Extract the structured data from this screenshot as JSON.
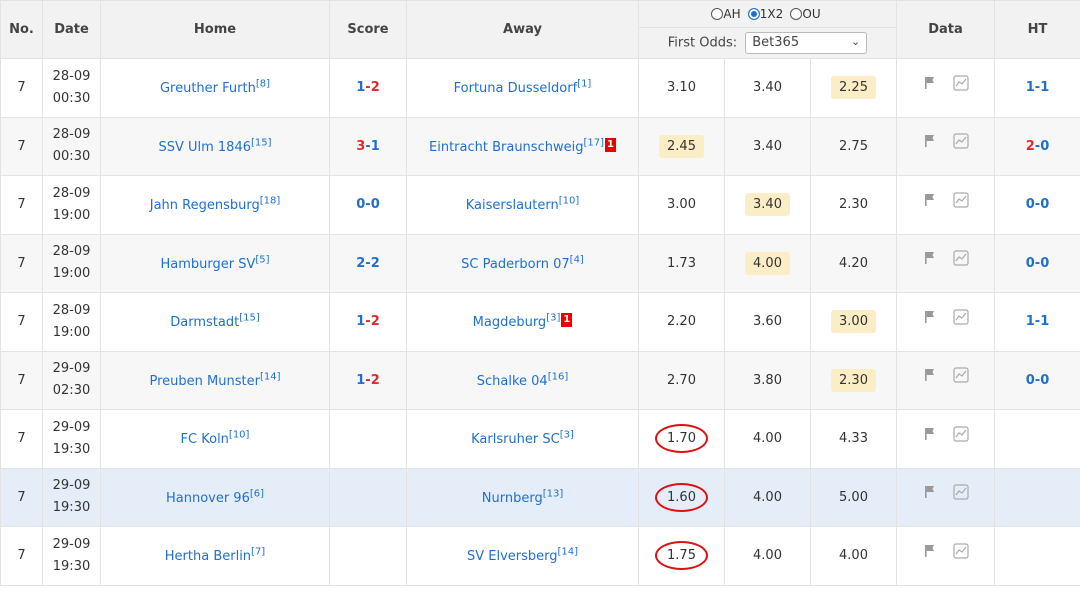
{
  "headers": {
    "no": "No.",
    "date": "Date",
    "home": "Home",
    "score": "Score",
    "away": "Away",
    "data": "Data",
    "ht": "HT"
  },
  "odds_types": [
    {
      "label": "AH",
      "selected": false
    },
    {
      "label": "1X2",
      "selected": true
    },
    {
      "label": "OU",
      "selected": false
    }
  ],
  "first_odds_label": "First Odds:",
  "bookmaker": "Bet365",
  "rows": [
    {
      "no": "7",
      "date": "28-09",
      "time": "00:30",
      "home": "Greuther Furth",
      "home_rank": "[8]",
      "score_home": "1",
      "score_away": "2",
      "away": "Fortuna Dusseldorf",
      "away_rank": "[1]",
      "away_card": "",
      "o1": "3.10",
      "ox": "3.40",
      "o2": "2.25",
      "ht_home": "1",
      "ht_away": "1"
    },
    {
      "no": "7",
      "date": "28-09",
      "time": "00:30",
      "home": "SSV Ulm 1846",
      "home_rank": "[15]",
      "score_home": "3",
      "score_away": "1",
      "away": "Eintracht Braunschweig",
      "away_rank": "[17]",
      "away_card": "1",
      "o1": "2.45",
      "ox": "3.40",
      "o2": "2.75",
      "ht_home": "2",
      "ht_away": "0"
    },
    {
      "no": "7",
      "date": "28-09",
      "time": "19:00",
      "home": "Jahn Regensburg",
      "home_rank": "[18]",
      "score_home": "0",
      "score_away": "0",
      "away": "Kaiserslautern",
      "away_rank": "[10]",
      "away_card": "",
      "o1": "3.00",
      "ox": "3.40",
      "o2": "2.30",
      "ht_home": "0",
      "ht_away": "0"
    },
    {
      "no": "7",
      "date": "28-09",
      "time": "19:00",
      "home": "Hamburger SV",
      "home_rank": "[5]",
      "score_home": "2",
      "score_away": "2",
      "away": "SC Paderborn 07",
      "away_rank": "[4]",
      "away_card": "",
      "o1": "1.73",
      "ox": "4.00",
      "o2": "4.20",
      "ht_home": "0",
      "ht_away": "0"
    },
    {
      "no": "7",
      "date": "28-09",
      "time": "19:00",
      "home": "Darmstadt",
      "home_rank": "[15]",
      "score_home": "1",
      "score_away": "2",
      "away": "Magdeburg",
      "away_rank": "[3]",
      "away_card": "1",
      "o1": "2.20",
      "ox": "3.60",
      "o2": "3.00",
      "ht_home": "1",
      "ht_away": "1"
    },
    {
      "no": "7",
      "date": "29-09",
      "time": "02:30",
      "home": "Preuben Munster",
      "home_rank": "[14]",
      "score_home": "1",
      "score_away": "2",
      "away": "Schalke 04",
      "away_rank": "[16]",
      "away_card": "",
      "o1": "2.70",
      "ox": "3.80",
      "o2": "2.30",
      "ht_home": "0",
      "ht_away": "0"
    },
    {
      "no": "7",
      "date": "29-09",
      "time": "19:30",
      "home": "FC Koln",
      "home_rank": "[10]",
      "score_home": "",
      "score_away": "",
      "away": "Karlsruher SC",
      "away_rank": "[3]",
      "away_card": "",
      "o1": "1.70",
      "ox": "4.00",
      "o2": "4.33",
      "ht_home": "",
      "ht_away": ""
    },
    {
      "no": "7",
      "date": "29-09",
      "time": "19:30",
      "home": "Hannover 96",
      "home_rank": "[6]",
      "score_home": "",
      "score_away": "",
      "away": "Nurnberg",
      "away_rank": "[13]",
      "away_card": "",
      "o1": "1.60",
      "ox": "4.00",
      "o2": "5.00",
      "ht_home": "",
      "ht_away": ""
    },
    {
      "no": "7",
      "date": "29-09",
      "time": "19:30",
      "home": "Hertha Berlin",
      "home_rank": "[7]",
      "score_home": "",
      "score_away": "",
      "away": "SV Elversberg",
      "away_rank": "[14]",
      "away_card": "",
      "o1": "1.75",
      "ox": "4.00",
      "o2": "4.00",
      "ht_home": "",
      "ht_away": ""
    }
  ],
  "colors": {
    "link": "#1f6fd1",
    "red": "#e02a2a",
    "header_bg": "#f2f2f2",
    "highlight_odd": "#fbeec6",
    "selected_row": "#e5edf8",
    "circle": "#d11"
  },
  "icons": [
    "flag-icon",
    "chart-icon"
  ]
}
